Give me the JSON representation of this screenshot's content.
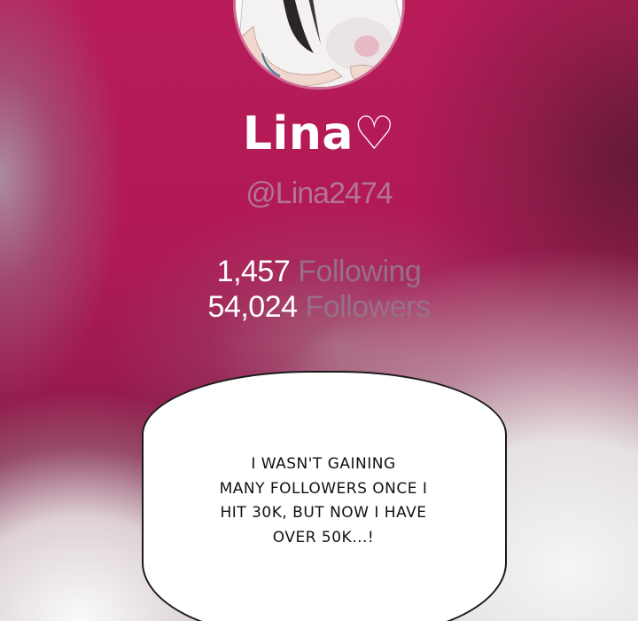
{
  "profile": {
    "name": "Lina♡",
    "handle": "@Lina2474"
  },
  "stats": {
    "following": {
      "count": "1,457",
      "label": "Following"
    },
    "followers": {
      "count": "54,024",
      "label": "Followers"
    }
  },
  "speech_bubble": {
    "lines": [
      "I WASN'T GAINING",
      "MANY FOLLOWERS ONCE I",
      "HIT 30K, BUT NOW I HAVE",
      "OVER 50K...!"
    ]
  },
  "colors": {
    "background_primary": "#b01a55",
    "name_text": "#ffffff",
    "handle_text": "#b47896",
    "stat_label": "#967387",
    "bubble_fill": "#ffffff",
    "bubble_outline": "#1a1a1a"
  }
}
